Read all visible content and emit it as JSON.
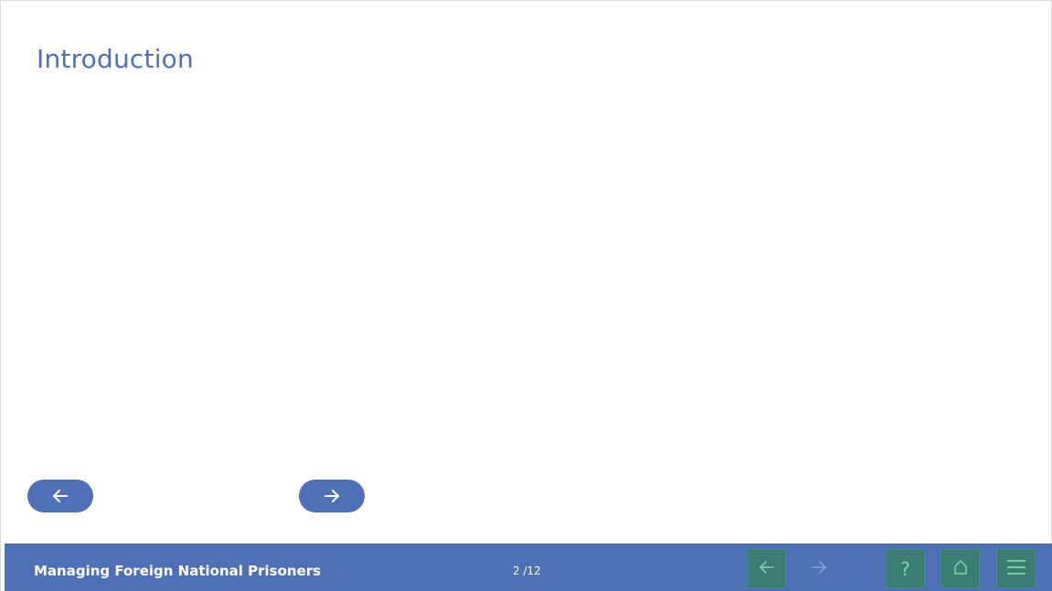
{
  "slide": {
    "title": "Introduction"
  },
  "content_nav": {
    "prev_icon": "arrow-left-icon",
    "next_icon": "arrow-right-icon"
  },
  "footer": {
    "course_title": "Managing Foreign National Prisoners",
    "page_counter": "2 /12",
    "buttons": {
      "back": {
        "icon": "arrow-left-icon"
      },
      "forward": {
        "icon": "arrow-right-icon",
        "state": "disabled"
      },
      "help": {
        "icon": "question-icon",
        "glyph": "?"
      },
      "home": {
        "icon": "home-icon",
        "glyph": "⌂"
      },
      "menu": {
        "icon": "hamburger-menu-icon"
      }
    }
  },
  "colors": {
    "brand_blue": "#4f70b7",
    "nav_button_bg": "#3b7d73",
    "nav_icon": "#7fd9a6",
    "text_white": "#ffffff"
  }
}
